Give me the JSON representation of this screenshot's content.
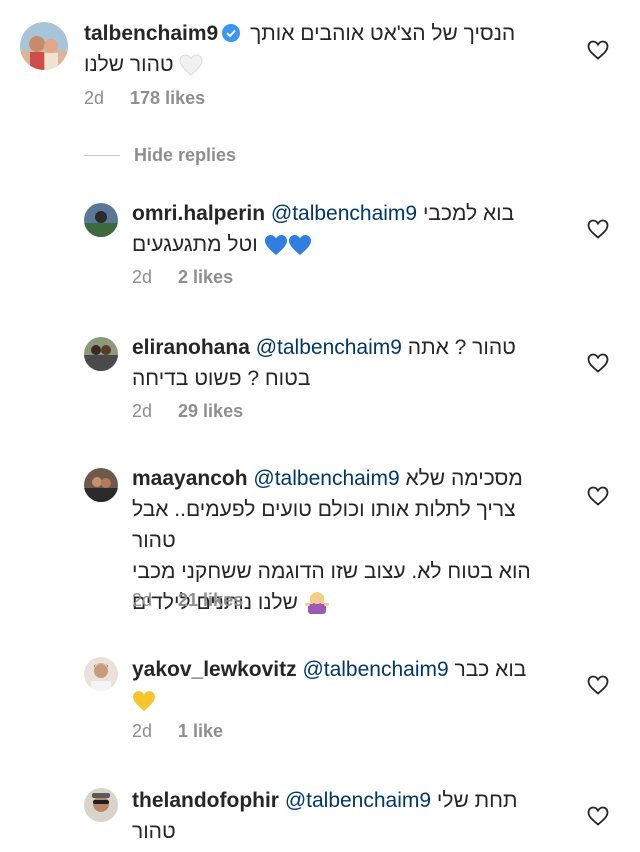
{
  "hide_replies_label": "Hide replies",
  "colors": {
    "mention": "#00376b",
    "meta": "#8e8e8e",
    "text": "#262626"
  },
  "comments": [
    {
      "username": "talbenchaim9",
      "verified": true,
      "text_line1": "הנסיך של הצ'אט אוהבים אותך",
      "text_line2": "טהור שלנו",
      "emoji": "white-heart",
      "age": "2d",
      "likes": "178 likes"
    },
    {
      "username": "omri.halperin",
      "mention": "@talbenchaim9",
      "text_line1": "בוא למכבי",
      "text_line2": "וטל מתגעגעים",
      "emoji": "blue-heart",
      "age": "2d",
      "likes": "2 likes"
    },
    {
      "username": "eliranohana",
      "mention": "@talbenchaim9",
      "text_line1": "טהור ? אתה",
      "text_line2": "בטוח ? פשוט בדיחה",
      "age": "2d",
      "likes": "29 likes"
    },
    {
      "username": "maayancoh",
      "mention": "@talbenchaim9",
      "text_line1": "מסכימה שלא",
      "text_line2": "צריך לתלות אותו וכולם טועים לפעמים.. אבל טהור",
      "text_line3": "הוא בטוח לא. עצוב שזו הדוגמה ששחקני מכבי",
      "text_line4": "שלנו נותנים לילדים",
      "emoji": "woman-shrugging",
      "age": "2d",
      "likes": "21 likes"
    },
    {
      "username": "yakov_lewkovitz",
      "mention": "@talbenchaim9",
      "text_line1": "בוא כבר",
      "emoji": "yellow-heart",
      "age": "2d",
      "likes": "1 like"
    },
    {
      "username": "thelandofophir",
      "mention": "@talbenchaim9",
      "text_line1": "תחת שלי",
      "text_line2": "טהור"
    }
  ]
}
